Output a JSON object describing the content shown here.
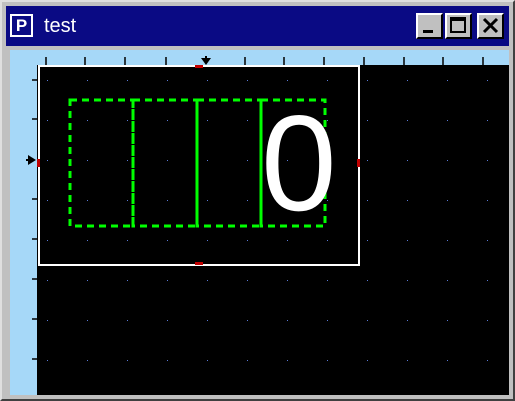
{
  "window": {
    "title": "test",
    "app_icon_letter": "P",
    "buttons": {
      "minimize": "minimize",
      "maximize": "maximize",
      "close": "close"
    }
  },
  "canvas": {
    "digit_text": "0",
    "colors": {
      "ruler": "#a6d8f8",
      "background": "#000000",
      "frame": "#ffffff",
      "segment_boxes": "#00ff00",
      "grid_dots": "#5a7ad8",
      "handles": "#c00000"
    },
    "segment_box_count": 4
  }
}
